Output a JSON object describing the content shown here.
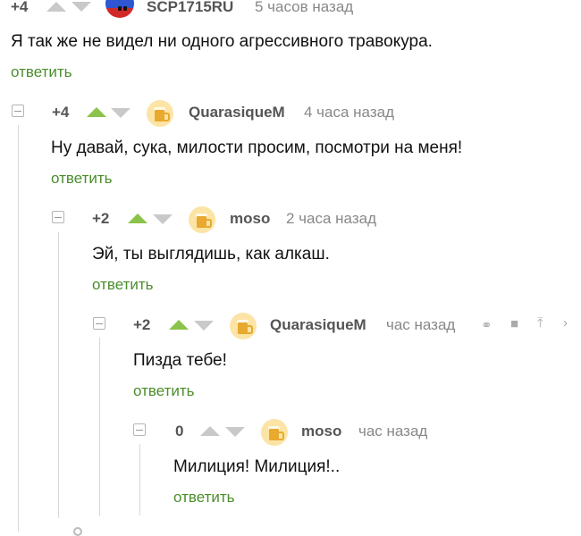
{
  "comments": [
    {
      "rating": "+4",
      "author": "SCP1715RU",
      "time": "5 часов назад",
      "text": "Я так же не видел ни одного агрессивного травокура.",
      "reply_label": "ответить",
      "vote": "none",
      "avatar": "flag-avatar"
    },
    {
      "rating": "+4",
      "author": "QuarasiqueM",
      "time": "4 часа назад",
      "text": "Ну давай, сука, милости просим, посмотри на меня!",
      "reply_label": "ответить",
      "vote": "up",
      "avatar": "beer-avatar"
    },
    {
      "rating": "+2",
      "author": "moso",
      "time": "2 часа назад",
      "text": "Эй, ты выглядишь, как алкаш.",
      "reply_label": "ответить",
      "vote": "up",
      "avatar": "beer-avatar"
    },
    {
      "rating": "+2",
      "author": "QuarasiqueM",
      "time": "час назад",
      "text": "Пизда тебе!",
      "reply_label": "ответить",
      "vote": "up",
      "avatar": "beer-avatar",
      "tools": [
        "link-icon",
        "save-icon",
        "upload-icon"
      ]
    },
    {
      "rating": "0",
      "author": "moso",
      "time": "час назад",
      "text": "Милиция! Милиция!..",
      "reply_label": "ответить",
      "vote": "none",
      "avatar": "beer-avatar"
    }
  ],
  "colors": {
    "reply_link": "#4b8d2c",
    "upvote_active": "#8bc34a",
    "vote_inactive": "#c9c9c9",
    "meta_text": "#888888"
  }
}
